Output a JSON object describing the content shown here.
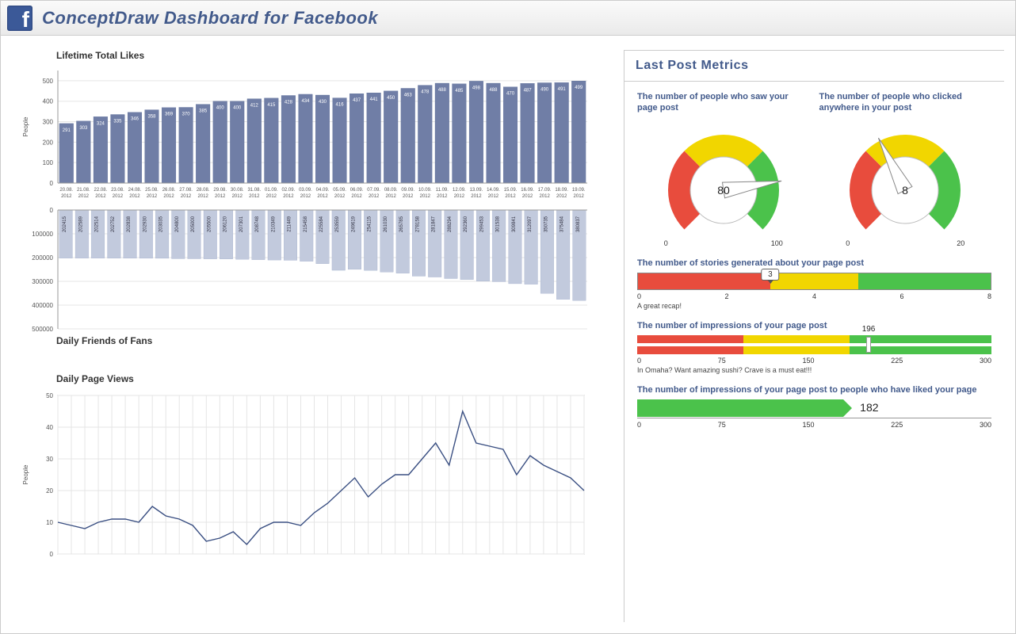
{
  "header": {
    "title": "ConceptDraw Dashboard for Facebook"
  },
  "likes": {
    "title": "Lifetime Total Likes",
    "ylabel": "People",
    "ylim": [
      0,
      550
    ],
    "yticks": [
      0,
      100,
      200,
      300,
      400,
      500
    ],
    "points": [
      {
        "date": "20.08.2012",
        "v": 291
      },
      {
        "date": "21.08.2012",
        "v": 303
      },
      {
        "date": "22.08.2012",
        "v": 324
      },
      {
        "date": "23.08.2012",
        "v": 335
      },
      {
        "date": "24.08.2012",
        "v": 346
      },
      {
        "date": "25.08.2012",
        "v": 358
      },
      {
        "date": "26.08.2012",
        "v": 369
      },
      {
        "date": "27.08.2012",
        "v": 370
      },
      {
        "date": "28.08.2012",
        "v": 385
      },
      {
        "date": "29.08.2012",
        "v": 400
      },
      {
        "date": "30.08.2012",
        "v": 400
      },
      {
        "date": "31.08.2012",
        "v": 412
      },
      {
        "date": "01.09.2012",
        "v": 415
      },
      {
        "date": "02.09.2012",
        "v": 428
      },
      {
        "date": "03.09.2012",
        "v": 434
      },
      {
        "date": "04.09.2012",
        "v": 430
      },
      {
        "date": "05.09.2012",
        "v": 416
      },
      {
        "date": "06.09.2012",
        "v": 437
      },
      {
        "date": "07.09.2012",
        "v": 441
      },
      {
        "date": "08.09.2012",
        "v": 450
      },
      {
        "date": "09.09.2012",
        "v": 463
      },
      {
        "date": "10.09.2012",
        "v": 478
      },
      {
        "date": "11.09.2012",
        "v": 488
      },
      {
        "date": "12.09.2012",
        "v": 485
      },
      {
        "date": "13.09.2012",
        "v": 498
      },
      {
        "date": "14.09.2012",
        "v": 488
      },
      {
        "date": "15.09.2012",
        "v": 470
      },
      {
        "date": "16.09.2012",
        "v": 487
      },
      {
        "date": "17.09.2012",
        "v": 490
      },
      {
        "date": "18.09.2012",
        "v": 491
      },
      {
        "date": "19.09.2012",
        "v": 499
      }
    ]
  },
  "friends": {
    "title": "Daily Friends of Fans",
    "ylim": [
      0,
      500000
    ],
    "yticks": [
      0,
      100000,
      200000,
      300000,
      400000,
      500000
    ],
    "points": [
      {
        "v": 202415
      },
      {
        "v": 202589
      },
      {
        "v": 202514
      },
      {
        "v": 202752
      },
      {
        "v": 202838
      },
      {
        "v": 202930
      },
      {
        "v": 203035
      },
      {
        "v": 204800
      },
      {
        "v": 205000
      },
      {
        "v": 205500
      },
      {
        "v": 206120
      },
      {
        "v": 207301
      },
      {
        "v": 208748
      },
      {
        "v": 210349
      },
      {
        "v": 211449
      },
      {
        "v": 215458
      },
      {
        "v": 225584
      },
      {
        "v": 253559
      },
      {
        "v": 249619
      },
      {
        "v": 254115
      },
      {
        "v": 261030
      },
      {
        "v": 265785
      },
      {
        "v": 278158
      },
      {
        "v": 281847
      },
      {
        "v": 288294
      },
      {
        "v": 292360
      },
      {
        "v": 299453
      },
      {
        "v": 301538
      },
      {
        "v": 309841
      },
      {
        "v": 312097
      },
      {
        "v": 350735
      },
      {
        "v": 375484
      },
      {
        "v": 380837
      }
    ]
  },
  "views": {
    "title": "Daily Page Views",
    "ylabel": "People",
    "ylim": [
      0,
      50
    ],
    "yticks": [
      0,
      10,
      20,
      30,
      40,
      50
    ],
    "points": [
      10,
      9,
      8,
      10,
      11,
      11,
      10,
      15,
      12,
      11,
      9,
      4,
      5,
      7,
      3,
      8,
      10,
      10,
      9,
      13,
      16,
      20,
      24,
      18,
      22,
      25,
      25,
      30,
      35,
      28,
      45,
      35,
      34,
      33,
      25,
      31,
      28,
      26,
      24,
      20
    ]
  },
  "lastPost": {
    "panel_title": "Last Post Metrics",
    "gauge_saw": {
      "title": "The number of people who saw your page post",
      "min": 0,
      "max": 100,
      "value": 80
    },
    "gauge_click": {
      "title": "The number of people who clicked anywhere in your post",
      "min": 0,
      "max": 20,
      "value": 8
    },
    "stories": {
      "title": "The number of stories generated about your page post",
      "min": 0,
      "max": 8,
      "value": 3,
      "ticks": [
        0,
        2,
        4,
        6,
        8
      ],
      "caption": "A great recap!"
    },
    "impressions": {
      "title": "The number of impressions of your page post",
      "min": 0,
      "max": 300,
      "value": 196,
      "ticks": [
        0,
        75,
        150,
        225,
        300
      ],
      "caption": "In Omaha? Want amazing sushi? Crave is a must eat!!!"
    },
    "impressions_liked": {
      "title": "The number of impressions of your page post to people who have liked your page",
      "min": 0,
      "max": 300,
      "value": 182,
      "ticks": [
        0,
        75,
        150,
        225,
        300
      ]
    }
  },
  "chart_data": [
    {
      "type": "bar",
      "title": "Lifetime Total Likes",
      "ylabel": "People",
      "ylim": [
        0,
        550
      ],
      "categories": [
        "20.08.2012",
        "21.08.2012",
        "22.08.2012",
        "23.08.2012",
        "24.08.2012",
        "25.08.2012",
        "26.08.2012",
        "27.08.2012",
        "28.08.2012",
        "29.08.2012",
        "30.08.2012",
        "31.08.2012",
        "01.09.2012",
        "02.09.2012",
        "03.09.2012",
        "04.09.2012",
        "05.09.2012",
        "06.09.2012",
        "07.09.2012",
        "08.09.2012",
        "09.09.2012",
        "10.09.2012",
        "11.09.2012",
        "12.09.2012",
        "13.09.2012",
        "14.09.2012",
        "15.09.2012",
        "16.09.2012",
        "17.09.2012",
        "18.09.2012",
        "19.09.2012"
      ],
      "values": [
        291,
        303,
        324,
        335,
        346,
        358,
        369,
        370,
        385,
        400,
        400,
        412,
        415,
        428,
        434,
        430,
        416,
        437,
        441,
        450,
        463,
        478,
        488,
        485,
        498,
        488,
        470,
        487,
        490,
        491,
        499
      ]
    },
    {
      "type": "bar",
      "title": "Daily Friends of Fans",
      "ylim": [
        0,
        500000
      ],
      "values": [
        202415,
        202589,
        202514,
        202752,
        202838,
        202930,
        203035,
        204800,
        205000,
        205500,
        206120,
        207301,
        208748,
        210349,
        211449,
        215458,
        225584,
        253559,
        249619,
        254115,
        261030,
        265785,
        278158,
        281847,
        288294,
        292360,
        299453,
        301538,
        309841,
        312097,
        350735,
        375484,
        380837
      ]
    },
    {
      "type": "line",
      "title": "Daily Page Views",
      "ylabel": "People",
      "ylim": [
        0,
        50
      ],
      "values": [
        10,
        9,
        8,
        10,
        11,
        11,
        10,
        15,
        12,
        11,
        9,
        4,
        5,
        7,
        3,
        8,
        10,
        10,
        9,
        13,
        16,
        20,
        24,
        18,
        22,
        25,
        25,
        30,
        35,
        28,
        45,
        35,
        34,
        33,
        25,
        31,
        28,
        26,
        24,
        20
      ]
    }
  ]
}
